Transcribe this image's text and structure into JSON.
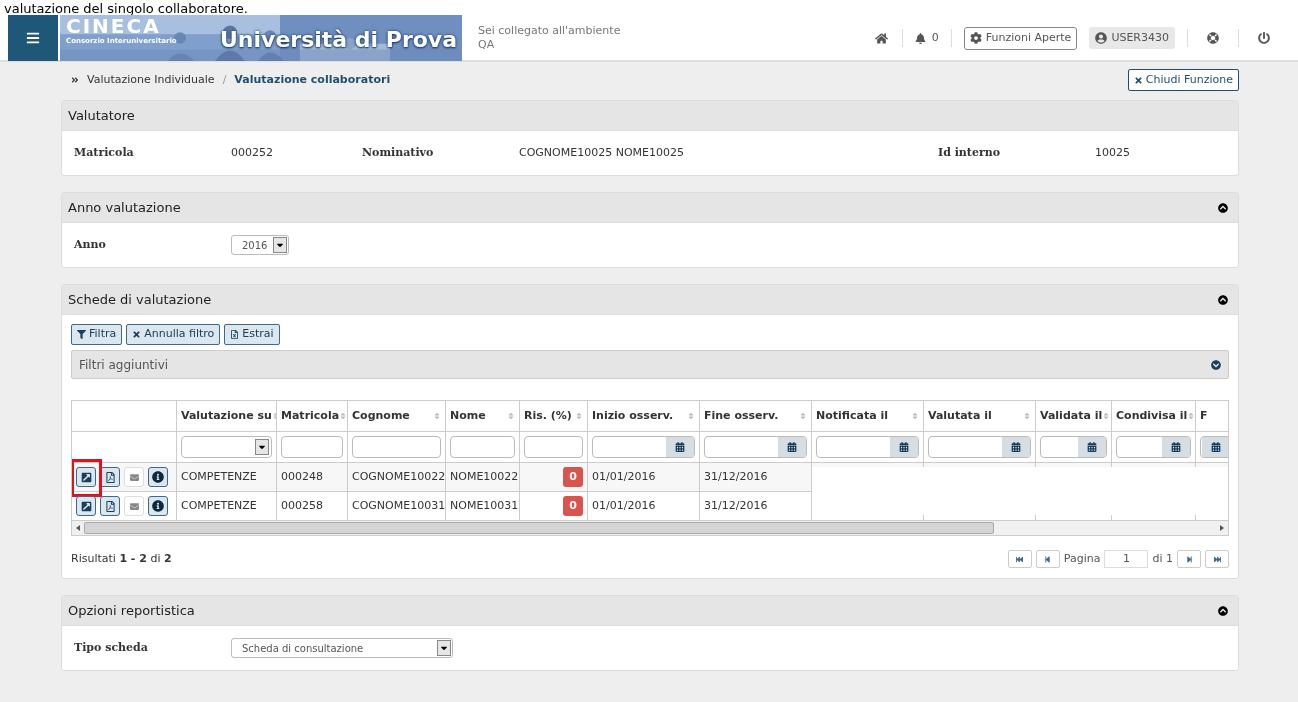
{
  "caption": "valutazione del singolo collaboratore.",
  "header": {
    "logo_top": "CINECA",
    "logo_sub": "Consorzio Interuniversitario",
    "title": "Università di Prova",
    "env_line1": "Sei collegato all'ambiente",
    "env_line2": "QA",
    "notifications": "0",
    "functions_button": "Funzioni Aperte",
    "user": "USER3430"
  },
  "breadcrumb": [
    {
      "label": "Valutazione Individuale",
      "selected": false
    },
    {
      "label": "Valutazione collaboratori",
      "selected": true
    }
  ],
  "breadcrumb_separator": "/",
  "close_button": "Chiudi Funzione",
  "valutatore": {
    "title": "Valutatore",
    "fields": [
      {
        "label": "Matricola",
        "value": "000252"
      },
      {
        "label": "Nominativo",
        "value": "COGNOME10025 NOME10025"
      },
      {
        "label": "Id interno",
        "value": "10025"
      }
    ]
  },
  "anno": {
    "title": "Anno valutazione",
    "label": "Anno",
    "value": "2016",
    "expanded": true
  },
  "schede": {
    "title": "Schede di valutazione",
    "expanded": true,
    "buttons": [
      {
        "kind": "filter",
        "label": "Filtra"
      },
      {
        "kind": "clear",
        "label": "Annulla filtro"
      },
      {
        "kind": "export",
        "label": "Estrai"
      }
    ],
    "extra_filters": {
      "title": "Filtri aggiuntivi",
      "expanded": false
    },
    "columns": [
      {
        "label": "Valutazione su",
        "kind": "select"
      },
      {
        "label": "Matricola",
        "kind": "text"
      },
      {
        "label": "Cognome",
        "kind": "text"
      },
      {
        "label": "Nome",
        "kind": "text"
      },
      {
        "label": "Ris. (%)",
        "kind": "text"
      },
      {
        "label": "Inizio osserv.",
        "kind": "date"
      },
      {
        "label": "Fine osserv.",
        "kind": "date"
      },
      {
        "label": "Notificata il",
        "kind": "date"
      },
      {
        "label": "Valutata il",
        "kind": "date"
      },
      {
        "label": "Validata il",
        "kind": "date"
      },
      {
        "label": "Condivisa il",
        "kind": "date"
      },
      {
        "label": "F",
        "kind": "date"
      }
    ],
    "rows": [
      {
        "cells": [
          "COMPETENZE",
          "000248",
          "COGNOME10022",
          "NOME10022",
          "0",
          "01/01/2016",
          "31/12/2016",
          "",
          "",
          "",
          "",
          ""
        ],
        "highlighted": true
      },
      {
        "cells": [
          "COMPETENZE",
          "000258",
          "COGNOME10031",
          "NOME10031",
          "0",
          "01/01/2016",
          "31/12/2016",
          "",
          "",
          "",
          "",
          ""
        ],
        "highlighted": false
      }
    ],
    "results_prefix": "Risultati",
    "results_range": "1 - 2",
    "results_of": "di",
    "results_total": "2",
    "pager": {
      "label": "Pagina",
      "page": "1",
      "of": "di 1"
    }
  },
  "report": {
    "title": "Opzioni reportistica",
    "label": "Tipo scheda",
    "value": "Scheda di consultazione",
    "expanded": true
  }
}
